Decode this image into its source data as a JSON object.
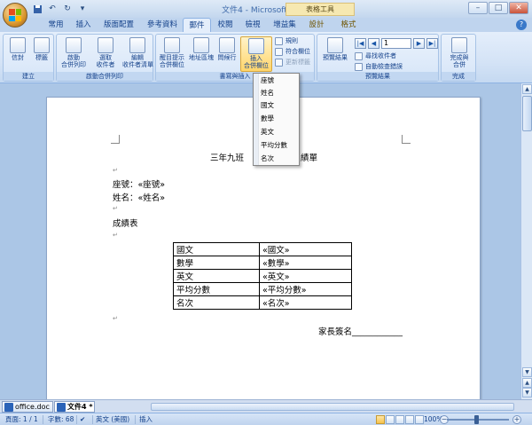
{
  "window": {
    "title": "文件4 - Microsoft Word",
    "context_title": "表格工具"
  },
  "quick_access": {
    "save_icon": "save-icon",
    "undo_icon": "undo-icon",
    "redo_icon": "redo-icon"
  },
  "tabs": [
    {
      "label": "常用"
    },
    {
      "label": "插入"
    },
    {
      "label": "版面配置"
    },
    {
      "label": "參考資料"
    },
    {
      "label": "郵件"
    },
    {
      "label": "校閱"
    },
    {
      "label": "檢視"
    },
    {
      "label": "增益集"
    },
    {
      "label": "設計"
    },
    {
      "label": "格式"
    }
  ],
  "ribbon": {
    "groups": {
      "create": {
        "label": "建立",
        "envelope": "信封",
        "labels": "標籤"
      },
      "start_merge": {
        "label": "啟動合併列印",
        "start_1": "啟動",
        "start_2": "合併列印",
        "select_1": "選取",
        "select_2": "收件者",
        "edit_1": "編輯",
        "edit_2": "收件者清單"
      },
      "write_insert": {
        "label": "書寫與插入",
        "highlight_1": "醒目提示",
        "highlight_2": "合併欄位",
        "address": "地址區塊",
        "greeting": "問候行",
        "insert_1": "插入",
        "insert_2": "合併欄位",
        "rules": "規則",
        "match": "符合欄位",
        "update": "更新標籤"
      },
      "preview": {
        "label": "預覽結果",
        "preview_btn": "預覽結果",
        "record": "1",
        "find": "尋找收件者",
        "auto_check": "自動檢查錯誤"
      },
      "finish": {
        "label": "完成",
        "finish_1": "完成與",
        "finish_2": "合併"
      }
    }
  },
  "merge_field_menu": {
    "items": [
      "座號",
      "姓名",
      "國文",
      "數學",
      "英文",
      "平均分數",
      "名次"
    ]
  },
  "document": {
    "title_left": "三年九班",
    "title_right": "績單",
    "seat_line": "座號：«座號»",
    "name_line": "姓名：«姓名»",
    "grades_heading": "成績表",
    "table": [
      {
        "subject": "國文",
        "field": "«國文»"
      },
      {
        "subject": "數學",
        "field": "«數學»"
      },
      {
        "subject": "英文",
        "field": "«英文»"
      },
      {
        "subject": "平均分數",
        "field": "«平均分數»"
      },
      {
        "subject": "名次",
        "field": "«名次»"
      }
    ],
    "signature": "家長簽名____________"
  },
  "doc_tabs": [
    {
      "label": "office.doc"
    },
    {
      "label": "文件4 *"
    }
  ],
  "status": {
    "page": "頁面: 1 / 1",
    "words": "字數: 68",
    "language": "英文 (美國)",
    "mode": "插入",
    "zoom": "100%"
  }
}
